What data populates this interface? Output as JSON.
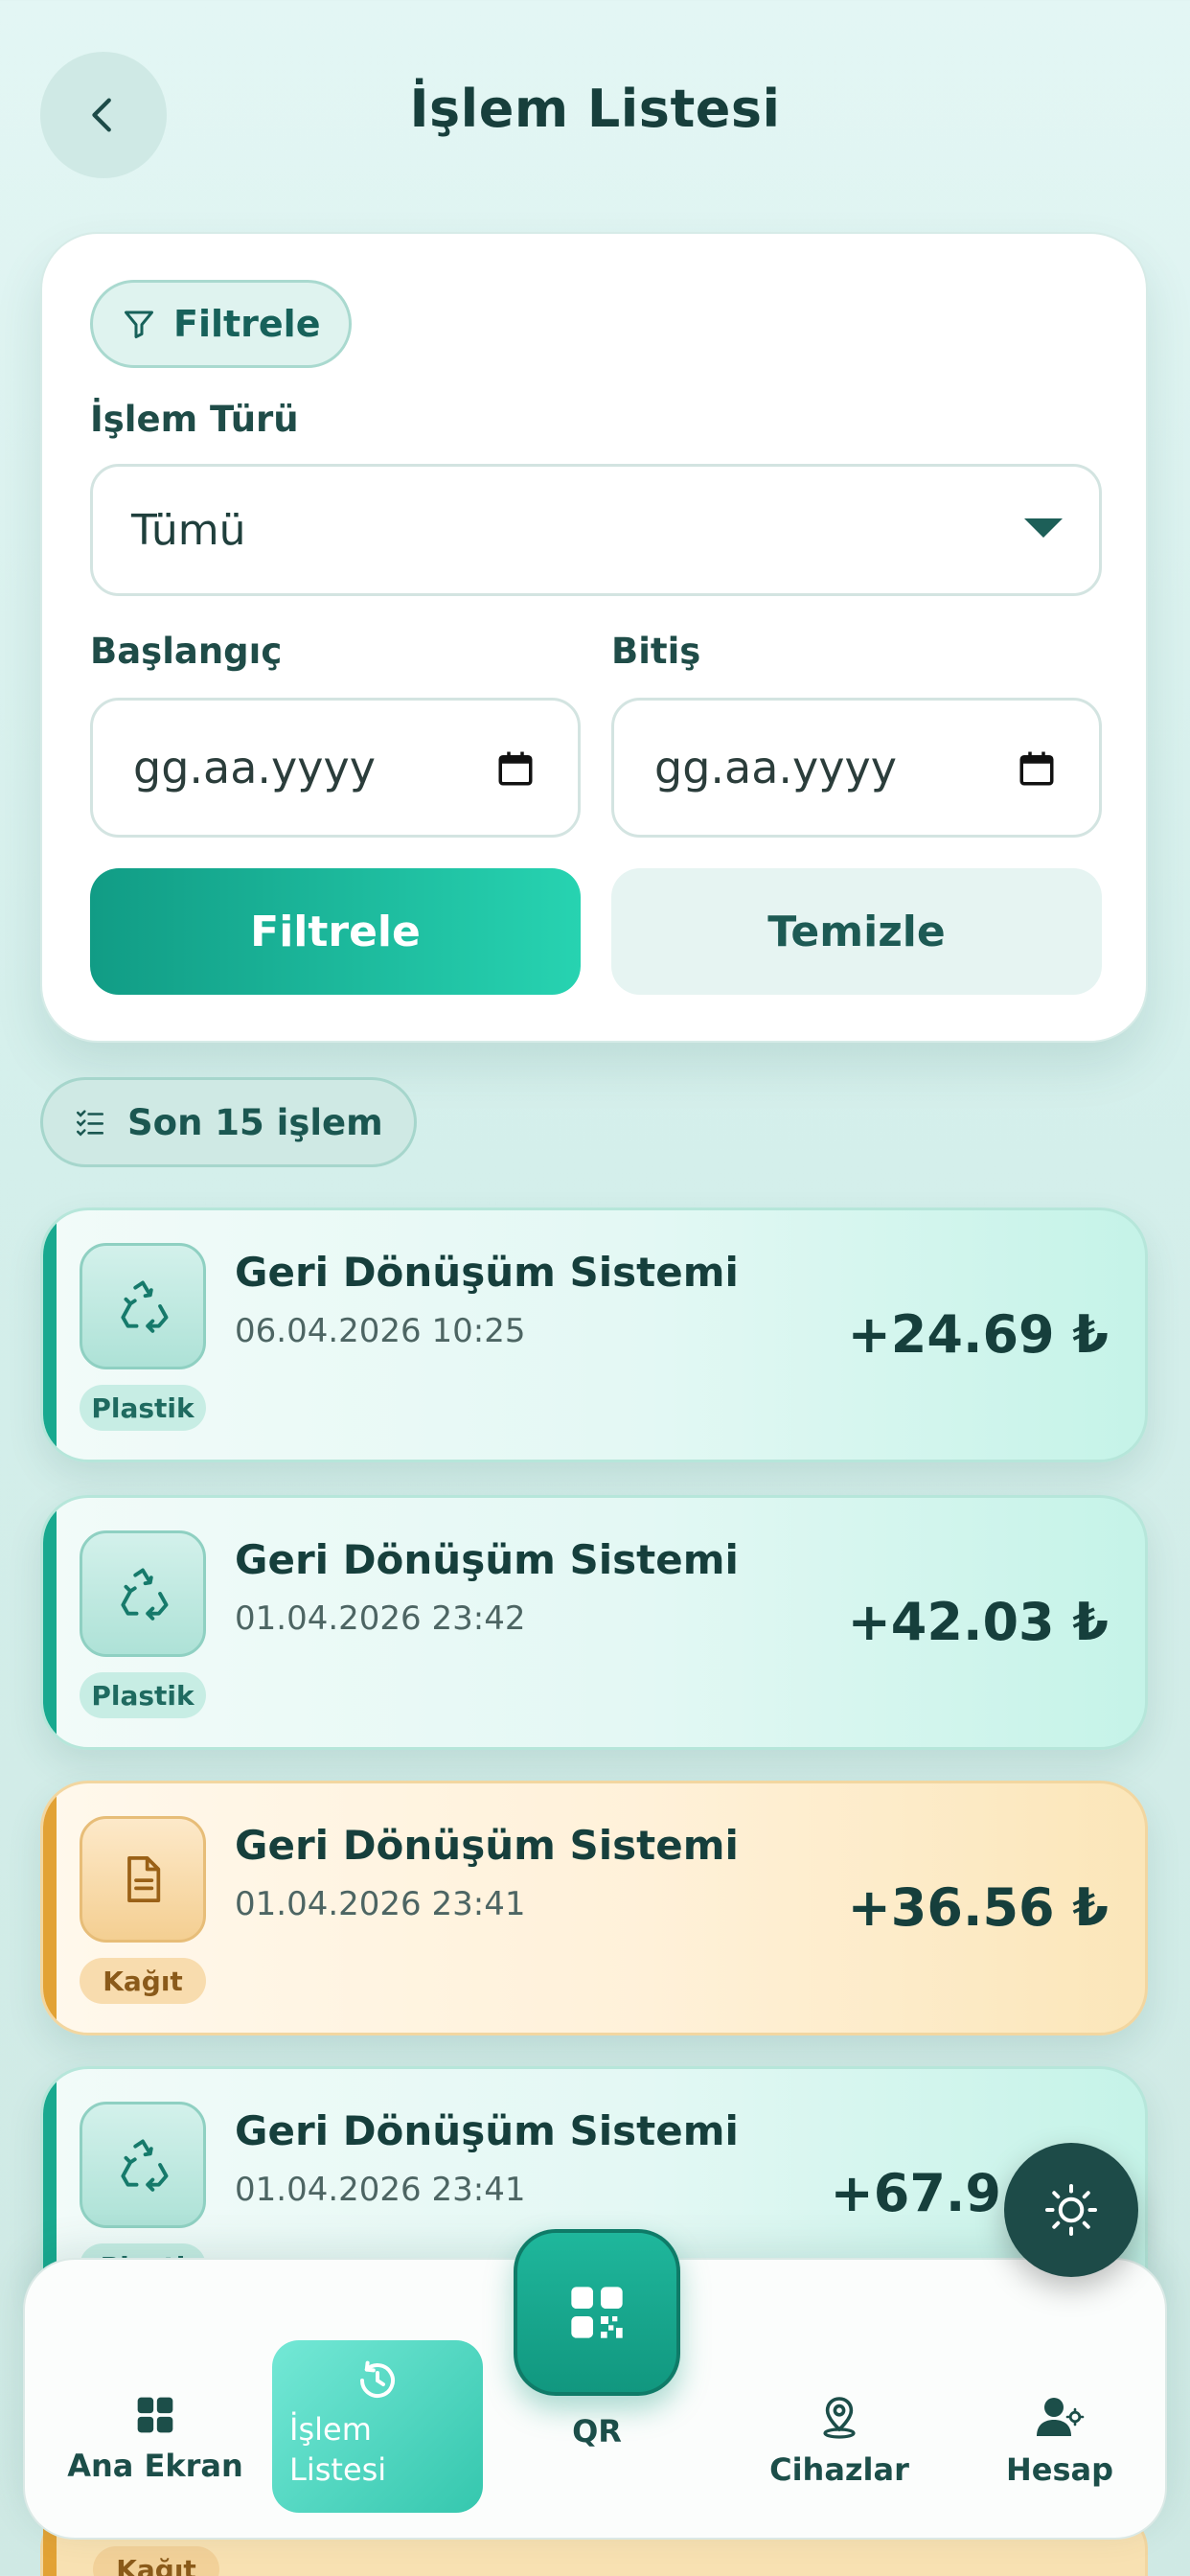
{
  "header": {
    "title": "İşlem Listesi"
  },
  "filter": {
    "chip_label": "Filtrele",
    "type_label": "İşlem Türü",
    "type_value": "Tümü",
    "start_label": "Başlangıç",
    "start_placeholder": "gg.aa.yyyy",
    "end_label": "Bitiş",
    "end_placeholder": "gg.aa.yyyy",
    "apply_label": "Filtrele",
    "clear_label": "Temizle"
  },
  "section": {
    "label": "Son 15 işlem"
  },
  "transactions": [
    {
      "title": "Geri Dönüşüm Sistemi",
      "date": "06.04.2026 10:25",
      "amount": "+24.69 ₺",
      "category": "Plastik",
      "icon": "recycle-icon"
    },
    {
      "title": "Geri Dönüşüm Sistemi",
      "date": "01.04.2026 23:42",
      "amount": "+42.03 ₺",
      "category": "Plastik",
      "icon": "recycle-icon"
    },
    {
      "title": "Geri Dönüşüm Sistemi",
      "date": "01.04.2026 23:41",
      "amount": "+36.56 ₺",
      "category": "Kağıt",
      "icon": "document-icon"
    },
    {
      "title": "Geri Dönüşüm Sistemi",
      "date": "01.04.2026 23:41",
      "amount": "+67.9",
      "category": "Plasti",
      "icon": "recycle-icon"
    }
  ],
  "peek": {
    "category": "Kağıt"
  },
  "nav": {
    "home": "Ana Ekran",
    "list_line1": "İşlem",
    "list_line2": "Listesi",
    "qr": "QR",
    "devices": "Cihazlar",
    "account": "Hesap"
  },
  "colors": {
    "primary": "#11977f",
    "accent_green": "#18a98f",
    "accent_orange": "#e2a235",
    "dark": "#163f3c"
  }
}
